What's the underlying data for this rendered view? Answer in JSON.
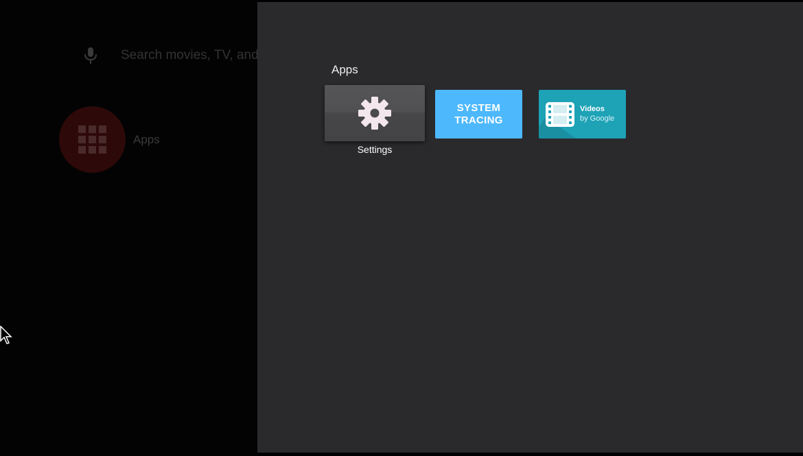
{
  "home": {
    "search_hint": "Search movies, TV, and",
    "apps_label": "Apps"
  },
  "panel": {
    "title": "Apps",
    "tiles": [
      {
        "label": "Settings",
        "icon": "gear-icon",
        "color": "#4d4c4e"
      },
      {
        "label_line1": "SYSTEM",
        "label_line2": "TRACING",
        "color": "#4db8fc"
      },
      {
        "title": "Videos",
        "subtitle": "by Google",
        "icon": "film-icon",
        "color": "#1ea2b6"
      }
    ]
  },
  "colors": {
    "panel_bg": "#2a292c",
    "home_bg": "#030303",
    "apps_circle": "#2e0909"
  }
}
